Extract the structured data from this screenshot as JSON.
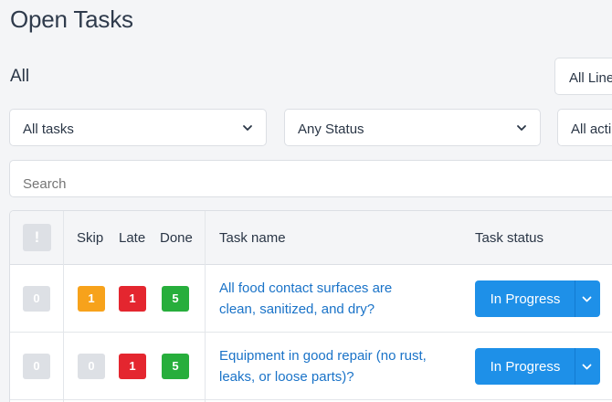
{
  "page": {
    "title": "Open Tasks",
    "section": "All"
  },
  "lines_dropdown": {
    "label": "All Line"
  },
  "filters": {
    "tasks": "All tasks",
    "status": "Any Status",
    "activity": "All acti"
  },
  "search": {
    "placeholder": "Search"
  },
  "table": {
    "headers": {
      "alert": "!",
      "skip": "Skip",
      "late": "Late",
      "done": "Done",
      "task_name": "Task name",
      "task_status": "Task status"
    },
    "rows": [
      {
        "alert": "0",
        "skip": "1",
        "late": "1",
        "done": "5",
        "task_line1": "All food contact surfaces are",
        "task_line2": "clean, sanitized, and dry?",
        "status": "In Progress"
      },
      {
        "alert": "0",
        "skip": "0",
        "late": "1",
        "done": "5",
        "task_line1": "Equipment in good repair (no rust,",
        "task_line2": "leaks, or loose parts)?",
        "status": "In Progress"
      }
    ]
  },
  "colors": {
    "skip_active": "#f7a21b",
    "late": "#e4262f",
    "done": "#27ae3c",
    "inactive": "#dde0e5",
    "primary": "#1e90e8",
    "link": "#1a73c8"
  }
}
